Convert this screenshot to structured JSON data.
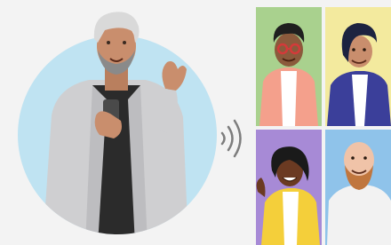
{
  "illustration": {
    "subject": "man-holding-phone",
    "signal_icon": "sound-waves-icon",
    "tiles": [
      {
        "name": "tile-person-red-glasses",
        "bg": "#a9d18e"
      },
      {
        "name": "tile-person-blue-suit",
        "bg": "#f3ea9e"
      },
      {
        "name": "tile-person-yellow-jacket",
        "bg": "#a78ad6"
      },
      {
        "name": "tile-person-bald-beard",
        "bg": "#8fc3ea"
      }
    ],
    "colors": {
      "background": "#f3f3f3",
      "circle": "#bfe3f2",
      "jacket": "#cfcfd1",
      "shirt": "#2b2b2b",
      "skin": "#c98e6d",
      "hair": "#d9d9d9"
    }
  }
}
